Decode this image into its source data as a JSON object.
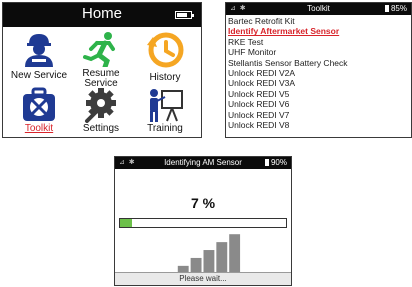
{
  "home": {
    "title": "Home",
    "battery_level": 0.8,
    "tiles": [
      {
        "label": "New Service",
        "icon": "technician-icon",
        "selected": false
      },
      {
        "label": "Resume Service",
        "label_line1": "Resume",
        "label_line2": "Service",
        "icon": "running-man-icon",
        "selected": false
      },
      {
        "label": "History",
        "icon": "clock-history-icon",
        "selected": false
      },
      {
        "label": "Toolkit",
        "icon": "toolkit-icon",
        "selected": true
      },
      {
        "label": "Settings",
        "icon": "gears-icon",
        "selected": false
      },
      {
        "label": "Training",
        "icon": "trainer-icon",
        "selected": false
      }
    ]
  },
  "toolkit": {
    "title": "Toolkit",
    "battery": "85%",
    "items": [
      "Bartec Retrofit Kit",
      "Identify Aftermarket Sensor",
      "RKE Test",
      "UHF Monitor",
      "Stellantis Sensor Battery Check",
      "Unlock REDI V2A",
      "Unlock REDI V3A",
      "Unlock REDI V5",
      "Unlock REDI V6",
      "Unlock REDI V7",
      "Unlock REDI V8"
    ],
    "selected_index": 1
  },
  "identify": {
    "title": "Identifying AM Sensor",
    "battery": "90%",
    "percent_text": "7 %",
    "progress": 0.07,
    "signal_bars": 5,
    "status": "Please wait..."
  },
  "colors": {
    "accent_red": "#d8232a",
    "icon_blue": "#1f3a93",
    "icon_green": "#2eb34a",
    "icon_orange": "#f5a623",
    "progress_green": "#6cc04a"
  }
}
